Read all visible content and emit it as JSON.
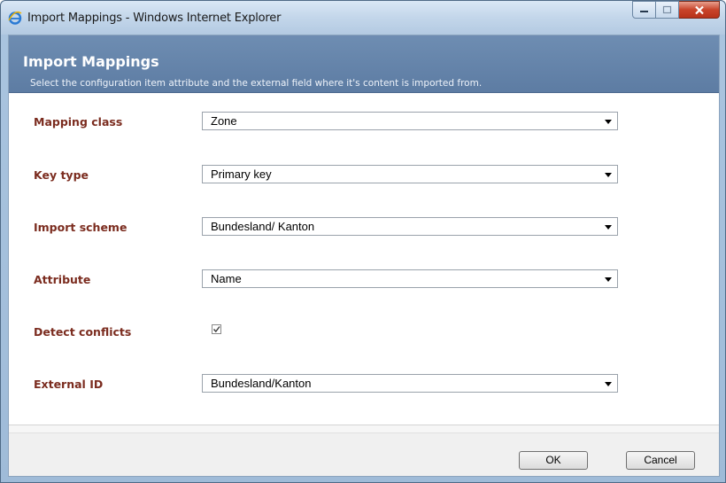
{
  "window": {
    "title": "Import Mappings - Windows Internet Explorer",
    "icon": "internet-explorer-icon"
  },
  "header": {
    "title": "Import Mappings",
    "subtitle": "Select the configuration item attribute and the external field where it's content is imported from."
  },
  "form": {
    "mapping_class": {
      "label": "Mapping class",
      "value": "Zone"
    },
    "key_type": {
      "label": "Key type",
      "value": "Primary key"
    },
    "import_scheme": {
      "label": "Import scheme",
      "value": "Bundesland/ Kanton"
    },
    "attribute": {
      "label": "Attribute",
      "value": "Name"
    },
    "detect_conflicts": {
      "label": "Detect conflicts",
      "checked": true
    },
    "external_id": {
      "label": "External ID",
      "value": "Bundesland/Kanton"
    }
  },
  "buttons": {
    "ok": "OK",
    "cancel": "Cancel"
  },
  "colors": {
    "header_bg": "#6383aa",
    "label_text": "#7b2c1f",
    "close_button": "#c8442a"
  }
}
